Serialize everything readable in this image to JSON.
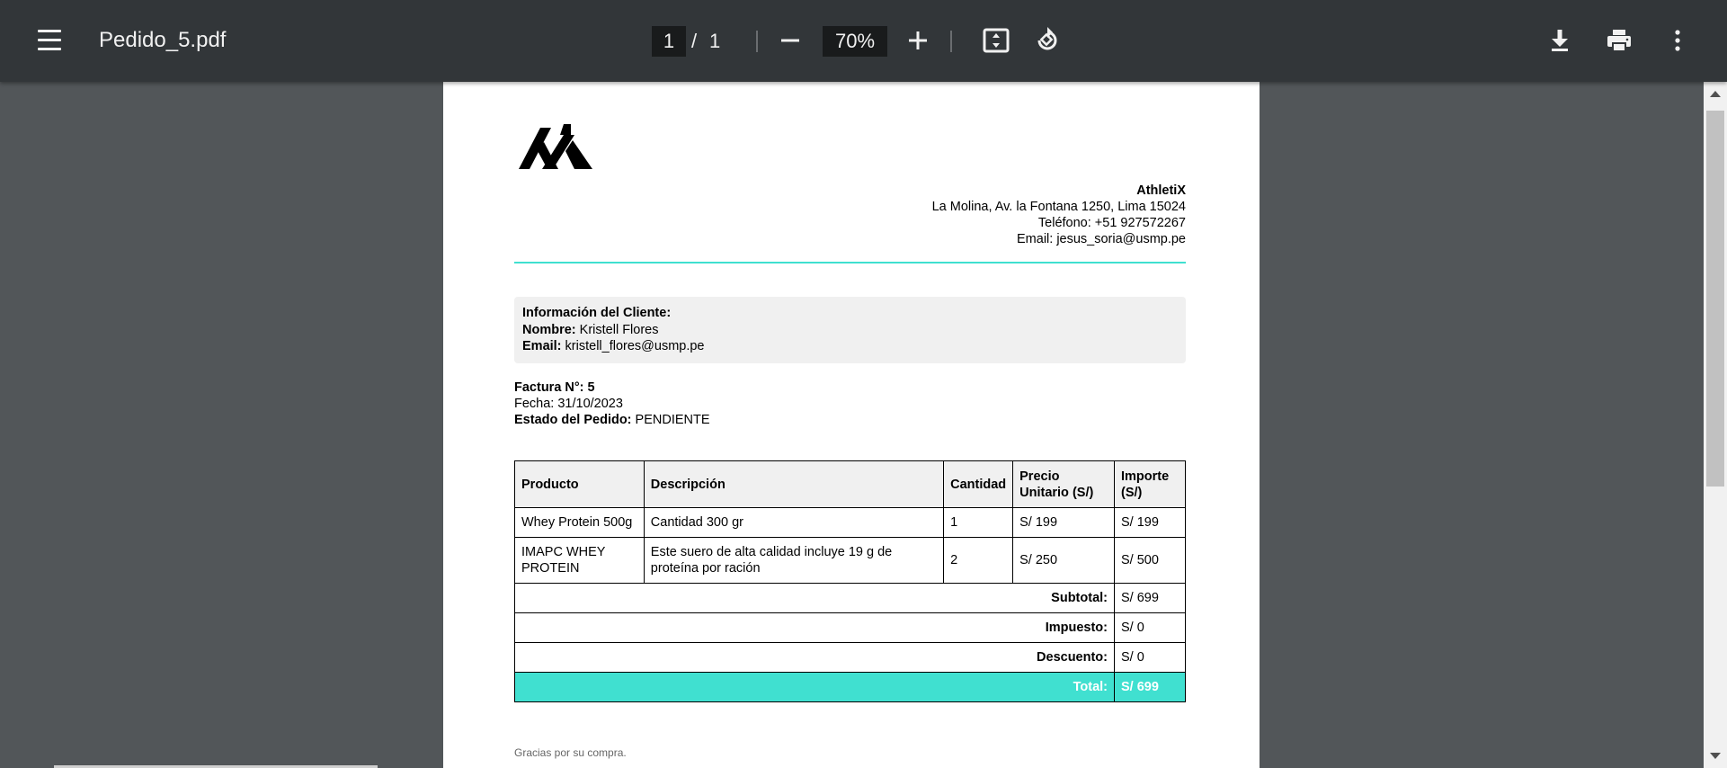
{
  "toolbar": {
    "file_name": "Pedido_5.pdf",
    "current_page": "1",
    "page_separator": "/",
    "total_pages": "1",
    "zoom": "70%"
  },
  "company": {
    "name": "AthletiX",
    "address": "La Molina, Av. la Fontana 1250, Lima 15024",
    "phone": "Teléfono: +51 927572267",
    "email": "Email: jesus_soria@usmp.pe",
    "accent_color": "#40e0d0"
  },
  "client": {
    "heading": "Información del Cliente:",
    "name_label": "Nombre:",
    "name": "Kristell Flores",
    "email_label": "Email:",
    "email": "kristell_flores@usmp.pe"
  },
  "invoice": {
    "number_label": "Factura N°:",
    "number": "5",
    "date": "Fecha: 31/10/2023",
    "status_label": "Estado del Pedido:",
    "status": "PENDIENTE"
  },
  "table": {
    "headers": {
      "product": "Producto",
      "description": "Descripción",
      "quantity": "Cantidad",
      "unit_price": "Precio Unitario (S/)",
      "amount": "Importe (S/)"
    },
    "rows": [
      {
        "product": "Whey Protein 500g",
        "description": "Cantidad 300 gr",
        "quantity": "1",
        "unit_price": "S/ 199",
        "amount": "S/ 199"
      },
      {
        "product": "IMAPC WHEY PROTEIN",
        "description": "Este suero de alta calidad incluye 19 g de proteína por ración",
        "quantity": "2",
        "unit_price": "S/ 250",
        "amount": "S/ 500"
      }
    ],
    "summary": {
      "subtotal_label": "Subtotal:",
      "subtotal": "S/ 699",
      "tax_label": "Impuesto:",
      "tax": "S/ 0",
      "discount_label": "Descuento:",
      "discount": "S/ 0",
      "total_label": "Total:",
      "total": "S/ 699"
    }
  },
  "footer": {
    "note": "Gracias por su compra."
  },
  "icons": [
    "menu-icon",
    "zoom-out-icon",
    "zoom-in-icon",
    "fit-page-icon",
    "rotate-icon",
    "download-icon",
    "print-icon",
    "more-options-icon"
  ]
}
